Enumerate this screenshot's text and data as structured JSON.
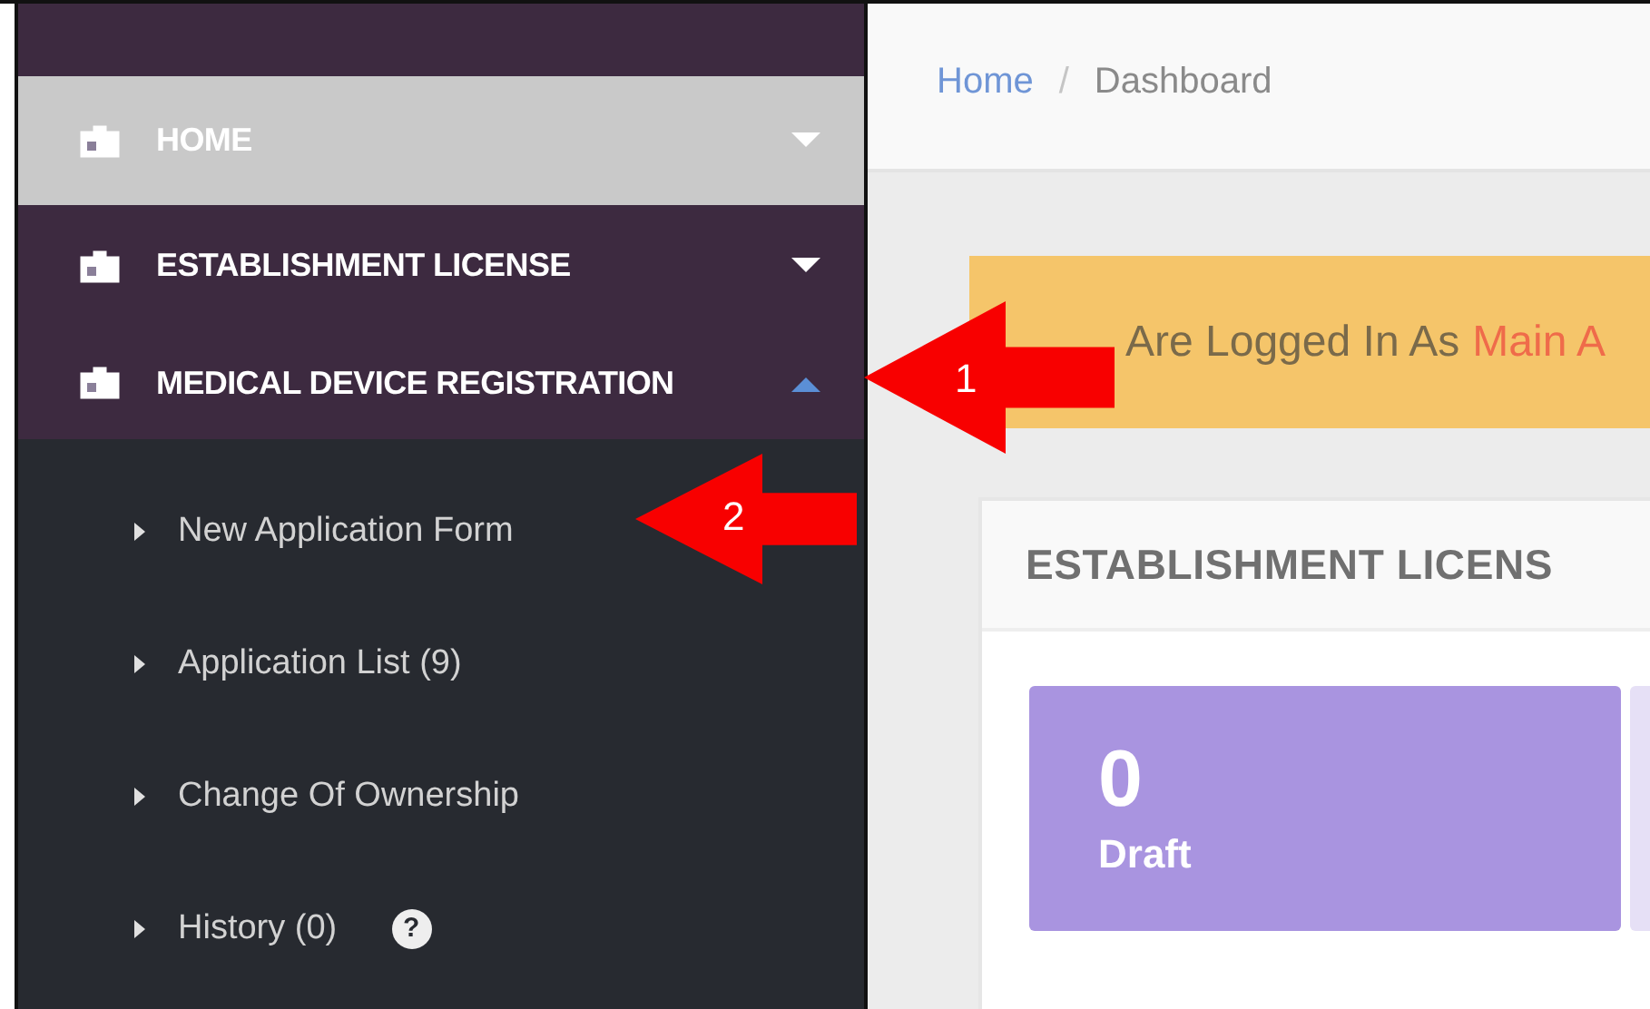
{
  "sidebar": {
    "sections": [
      {
        "label": "HOME",
        "selected": true,
        "expanded": false
      },
      {
        "label": "ESTABLISHMENT LICENSE",
        "selected": false,
        "expanded": false
      },
      {
        "label": "MEDICAL DEVICE REGISTRATION",
        "selected": false,
        "expanded": true,
        "children": [
          {
            "label": "New Application Form"
          },
          {
            "label": "Application List (9)"
          },
          {
            "label": "Change Of Ownership"
          },
          {
            "label": "History (0)",
            "help": "?"
          }
        ]
      }
    ]
  },
  "breadcrumb": {
    "items": [
      {
        "label": "Home",
        "kind": "link"
      },
      {
        "label": "Dashboard",
        "kind": "current"
      }
    ],
    "separator": "/"
  },
  "alert": {
    "text": "Are Logged In As",
    "highlight": "Main A"
  },
  "panel": {
    "title": "ESTABLISHMENT LICENS",
    "tiles": [
      {
        "value": "0",
        "label": "Draft",
        "color": "#a994e0"
      },
      {
        "color": "#e6e0f6"
      }
    ]
  },
  "callouts": [
    {
      "label": "1"
    },
    {
      "label": "2"
    }
  ]
}
